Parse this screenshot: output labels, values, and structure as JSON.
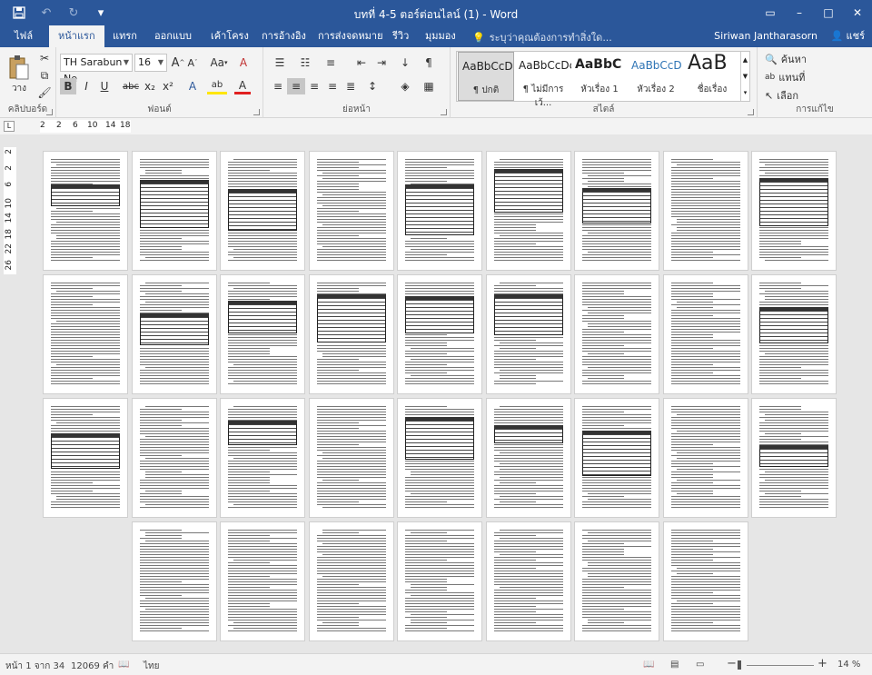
{
  "titlebar": {
    "title": "บทที่ 4-5 ตอร์ต่อนไลน์ (1) - Word",
    "save_icon": "save-icon",
    "undo_icon": "undo-icon",
    "redo_icon": "redo-icon",
    "qat_menu": "▾"
  },
  "window_controls": {
    "ribbon_options": "▭",
    "minimize": "–",
    "maximize": "□",
    "close": "✕"
  },
  "tabs": [
    {
      "label": "ไฟล์"
    },
    {
      "label": "หน้าแรก"
    },
    {
      "label": "แทรก"
    },
    {
      "label": "ออกแบบ"
    },
    {
      "label": "เค้าโครง"
    },
    {
      "label": "การอ้างอิง"
    },
    {
      "label": "การส่งจดหมาย"
    },
    {
      "label": "รีวิว"
    },
    {
      "label": "มุมมอง"
    }
  ],
  "tell_me": "ระบุว่าคุณต้องการทำสิ่งใด...",
  "user": {
    "name": "Siriwan Jantharasorn",
    "share_label": "แชร์"
  },
  "ribbon": {
    "clipboard": {
      "paste_label": "วาง",
      "group_label": "คลิปบอร์ด"
    },
    "font": {
      "font_name": "TH Sarabun Ne",
      "font_size": "16",
      "grow": "A",
      "shrink": "A",
      "change_case": "Aa",
      "clear": "A",
      "bold": "B",
      "italic": "I",
      "underline": "U",
      "strike": "abc",
      "subscript": "x₂",
      "superscript": "x²",
      "effects": "A",
      "highlight": "ab",
      "font_color": "A",
      "group_label": "ฟอนต์"
    },
    "paragraph": {
      "group_label": "ย่อหน้า",
      "pilcrow": "¶"
    },
    "styles": {
      "group_label": "สไตล์",
      "items": [
        {
          "preview": "AaBbCcDc",
          "name": "¶ ปกติ"
        },
        {
          "preview": "AaBbCcDc",
          "name": "¶ ไม่มีการเว้..."
        },
        {
          "preview": "AaBbC",
          "name": "หัวเรื่อง 1"
        },
        {
          "preview": "AaBbCcD",
          "name": "หัวเรื่อง 2"
        },
        {
          "preview": "AaB",
          "name": "ชื่อเรื่อง"
        }
      ]
    },
    "editing": {
      "find": "ค้นหา",
      "replace": "แทนที่",
      "select": "เลือก",
      "group_label": "การแก้ไข"
    }
  },
  "ruler": {
    "tab_selector": "L",
    "ticks": [
      "2",
      "2",
      "6",
      "10",
      "14",
      "18"
    ]
  },
  "vruler": {
    "ticks": [
      "2",
      "2",
      "6",
      "10",
      "14",
      "18",
      "22",
      "26"
    ]
  },
  "status": {
    "page": "หน้า 1 จาก 34",
    "words": "12069 คำ",
    "language": "ไทย",
    "zoom": "14 %",
    "zoom_minus": "−",
    "zoom_plus": "+"
  },
  "document": {
    "page_count": 34
  }
}
